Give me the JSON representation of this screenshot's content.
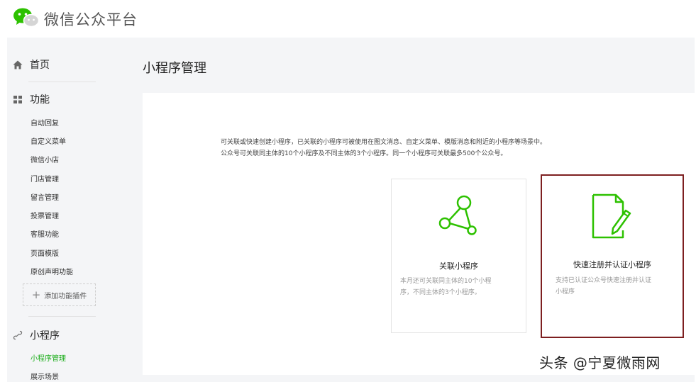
{
  "header": {
    "brand": "微信公众平台"
  },
  "sidebar": {
    "home": "首页",
    "functions": {
      "label": "功能",
      "items": [
        "自动回复",
        "自定义菜单",
        "微信小店",
        "门店管理",
        "留言管理",
        "投票管理",
        "客服功能",
        "页面模版",
        "原创声明功能"
      ],
      "add_plugin": "添加功能插件"
    },
    "mini": {
      "label": "小程序",
      "items": [
        "小程序管理",
        "展示场景"
      ],
      "active_index": 0
    }
  },
  "main": {
    "title": "小程序管理",
    "desc_line1": "可关联或快速创建小程序，已关联的小程序可被使用在图文消息、自定义菜单、模版消息和附近的小程序等场景中。",
    "desc_line2": "公众号可关联同主体的10个小程序及不同主体的3个小程序。同一个小程序可关联最多500个公众号。",
    "options": [
      {
        "icon": "link-nodes-icon",
        "title": "关联小程序",
        "desc_line1": "本月还可关联同主体的10个小程",
        "desc_line2": "序，不同主体的3个小程序。"
      },
      {
        "icon": "register-document-icon",
        "title": "快速注册并认证小程序",
        "desc_line1": "支持已认证公众号快速注册并认证",
        "desc_line2": "小程序"
      }
    ]
  },
  "watermark": "头条 @宁夏微雨网",
  "colors": {
    "accent_green": "#1aad19",
    "highlight_border": "#7d1f20",
    "panel_bg": "#f4f5f7"
  }
}
